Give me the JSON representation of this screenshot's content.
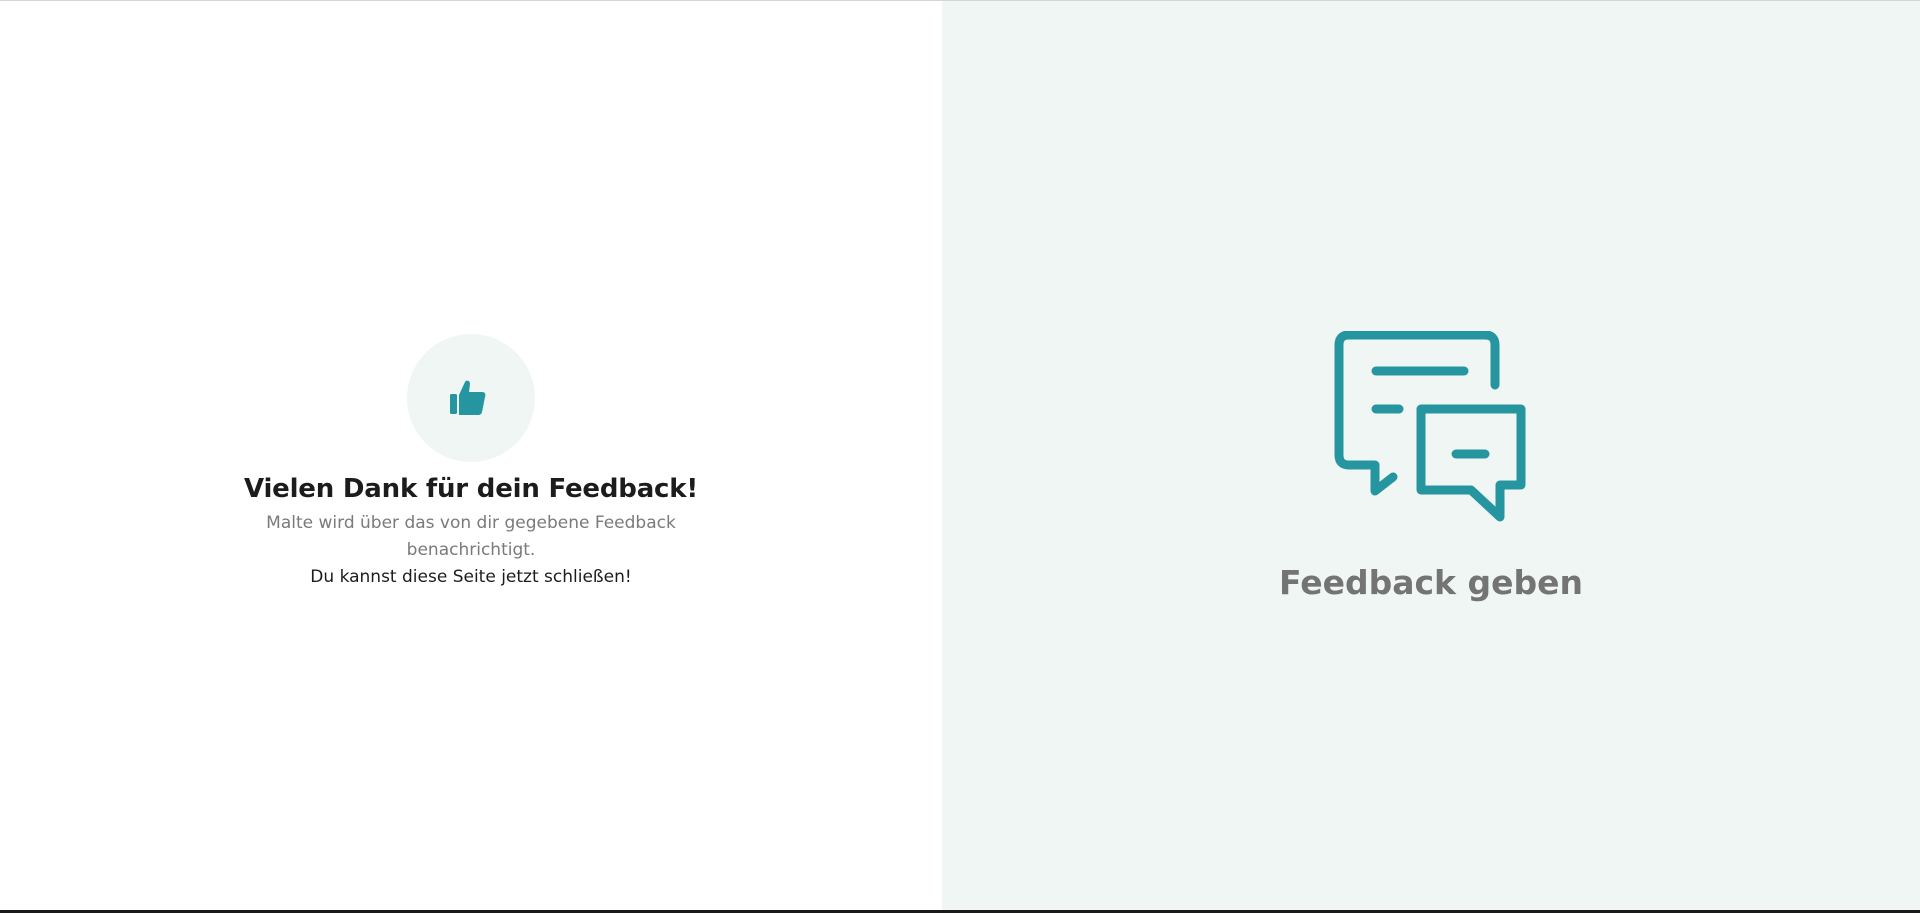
{
  "left": {
    "thumb_icon": "thumbs-up-icon",
    "title": "Vielen Dank für dein Feedback!",
    "subtitle": "Malte wird über das von dir gegebene Feedback benachrichtigt.",
    "close_hint": "Du kannst diese Seite jetzt schließen!"
  },
  "right": {
    "icon": "chat-bubbles-icon",
    "label": "Feedback geben"
  },
  "colors": {
    "accent": "#2595a0",
    "left_background": "#ffffff",
    "right_background": "#f0f6f4",
    "thumb_circle": "#eff6f4",
    "title_text": "#1c1c1c",
    "muted_text": "#7a7a7a",
    "feedback_label": "#747474"
  }
}
